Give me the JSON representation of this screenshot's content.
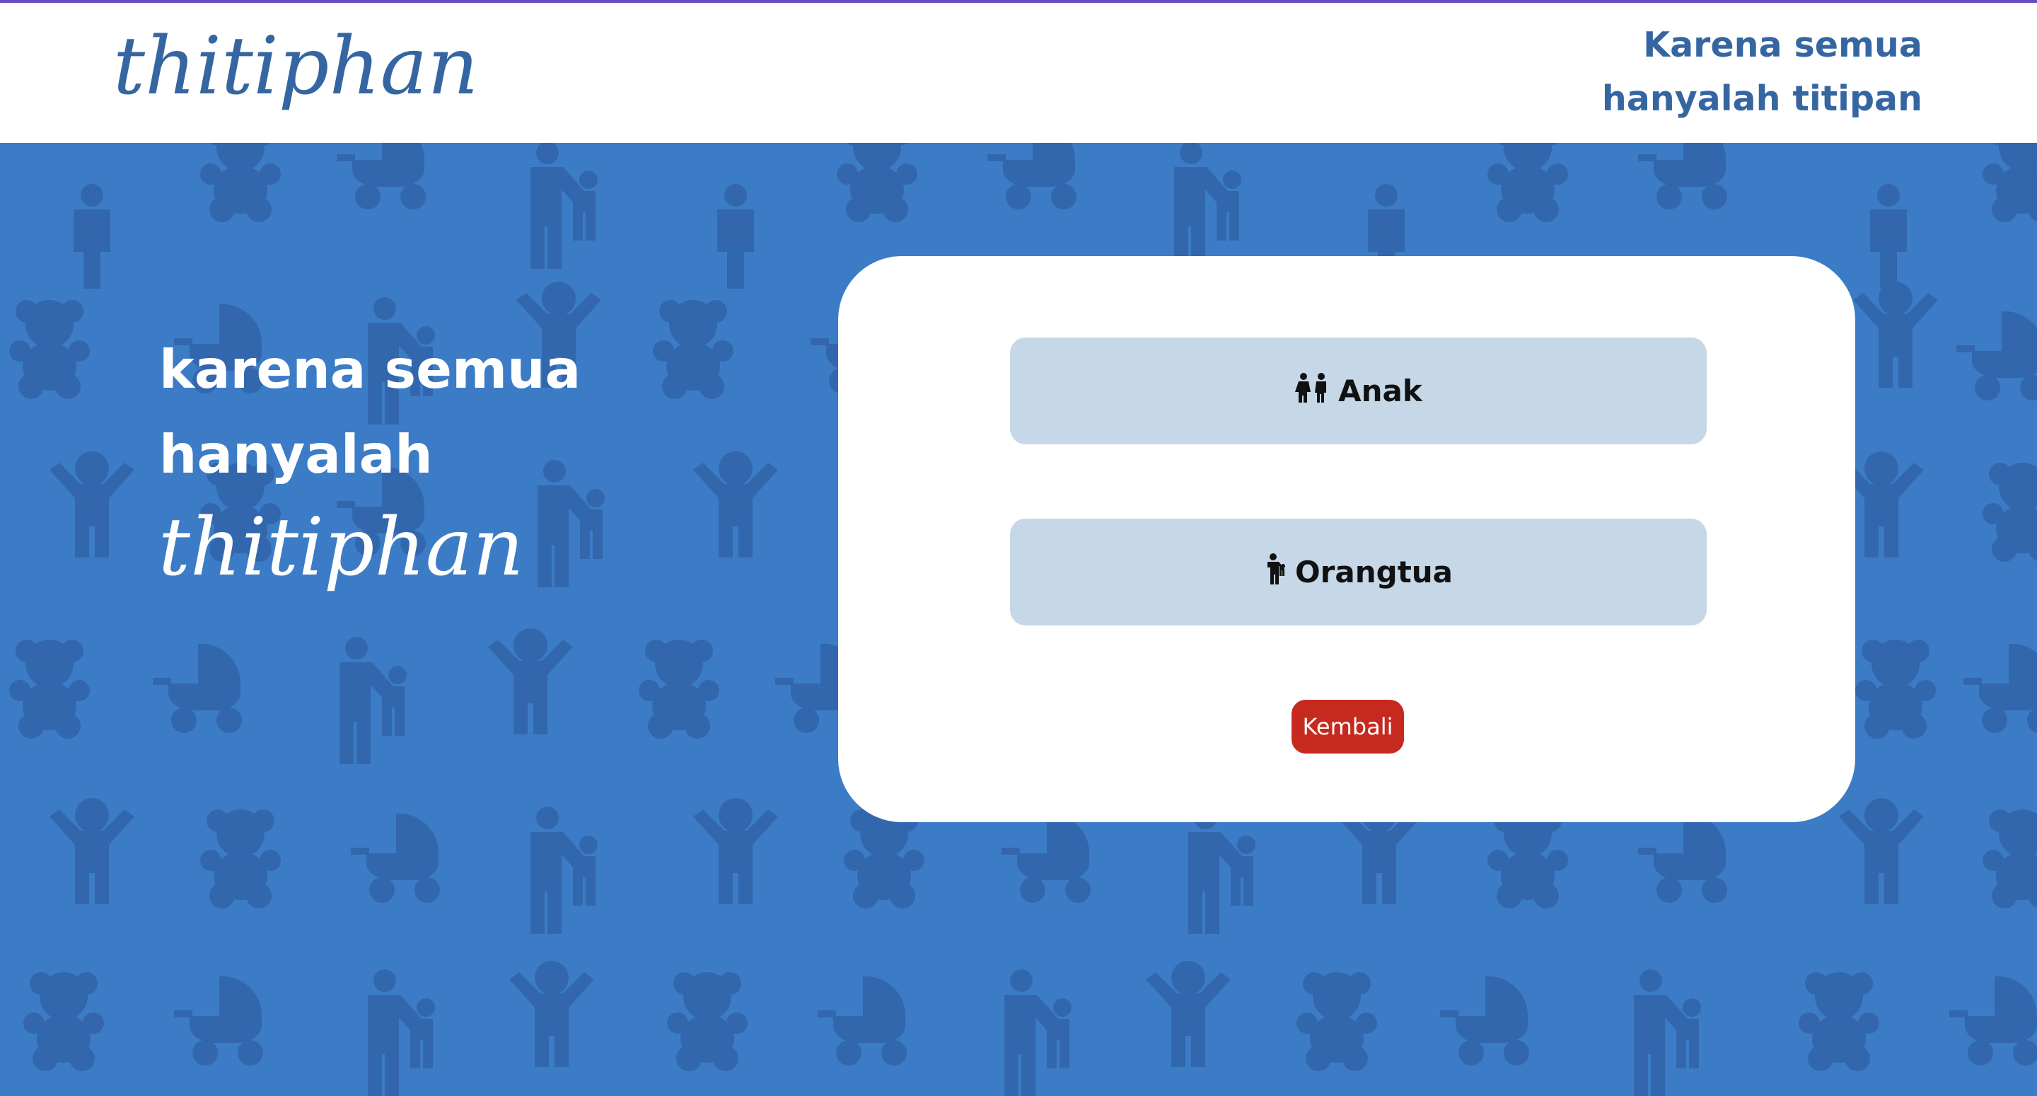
{
  "brand": {
    "logo_text": "thitiphan",
    "tagline_line1": "Karena semua",
    "tagline_line2": "hanyalah titipan"
  },
  "hero": {
    "line1": "karena semua",
    "line2": "hanyalah",
    "logo_text": "thitiphan"
  },
  "roles": [
    {
      "label": "Anak",
      "icon": "children-icon"
    },
    {
      "label": "Orangtua",
      "icon": "parent-child-icon"
    }
  ],
  "back_label": "Kembali",
  "colors": {
    "brand_blue": "#3566a2",
    "hero_bg": "#3c7cc6",
    "pattern": "#3267ad",
    "button_bg": "#c6d7e8",
    "back_red": "#c62a1f"
  }
}
